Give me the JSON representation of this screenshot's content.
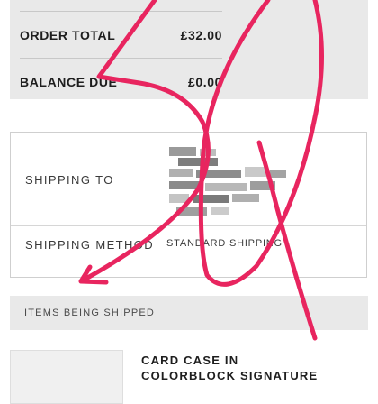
{
  "summary": {
    "order_total_label": "ORDER TOTAL",
    "order_total_value": "£32.00",
    "balance_due_label": "BALANCE DUE",
    "balance_due_value": "£0.00"
  },
  "shipping": {
    "to_label": "SHIPPING TO",
    "method_label": "SHIPPING METHOD",
    "method_value": "STANDARD SHIPPING"
  },
  "items": {
    "header": "ITEMS BEING SHIPPED",
    "first_item_name": "CARD CASE IN\nCOLORBLOCK SIGNATURE"
  },
  "colors": {
    "panel_gray": "#e9e9e9",
    "annotation_stroke": "#e8255f"
  }
}
